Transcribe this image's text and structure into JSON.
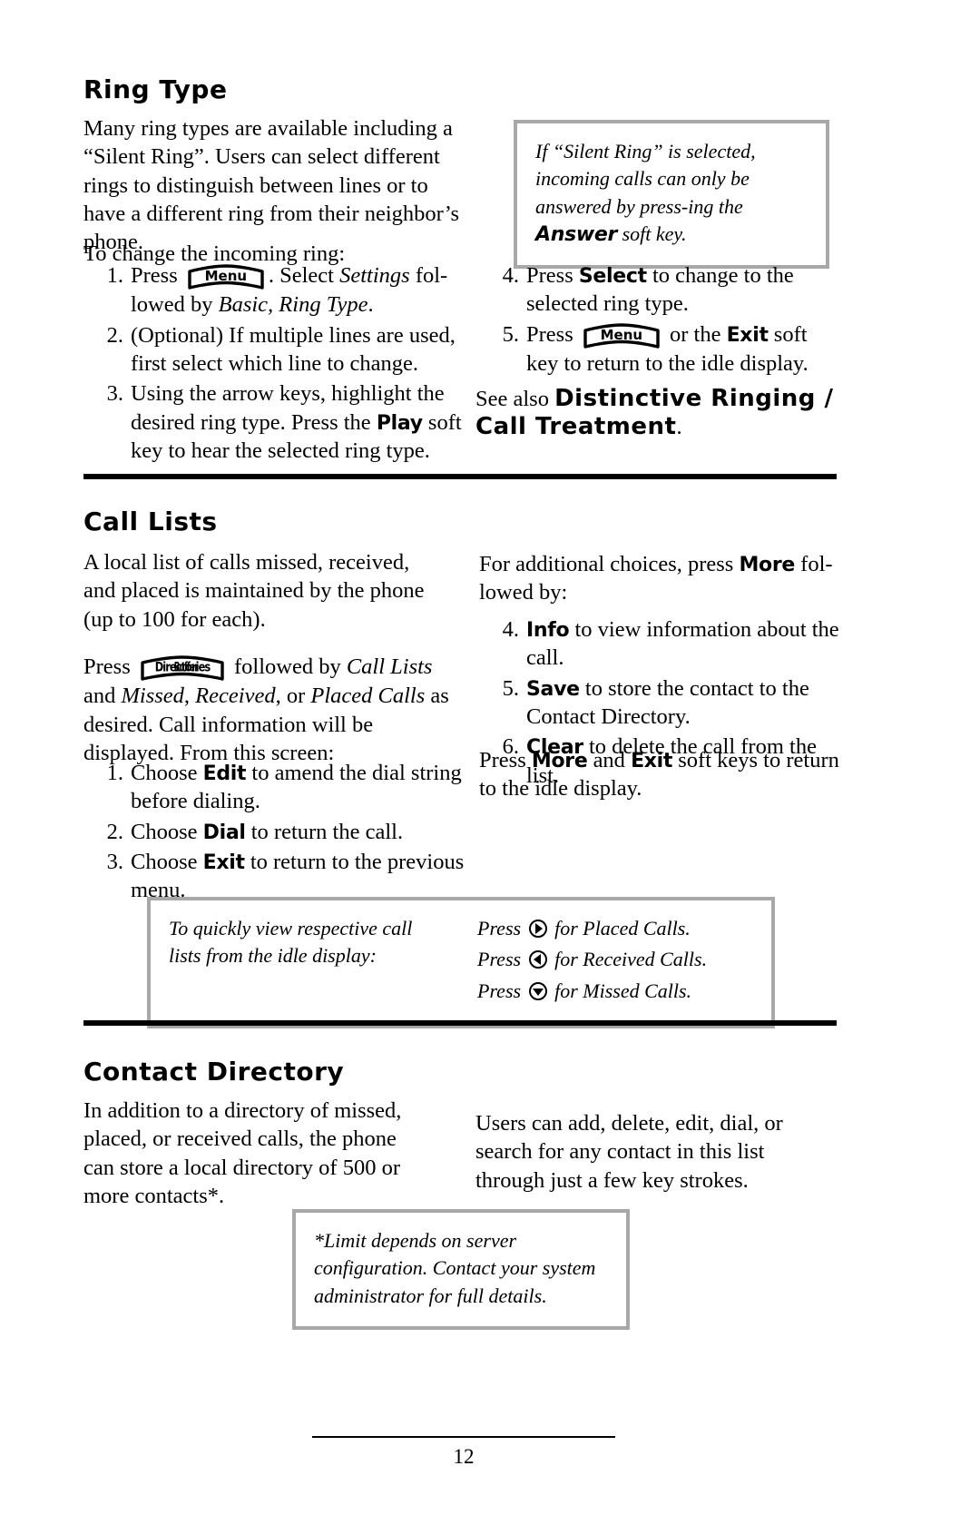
{
  "document": {
    "page_number": "12"
  },
  "sections": [
    {
      "id": "ring_type",
      "title": "Ring Type",
      "intro": "Many ring types are available including a “Silent Ring”.  Users can select different rings to distinguish between lines or to have a different ring from their neighbor’s phone.",
      "lead_in": "To change the incoming ring:",
      "steps_left": [
        {
          "num": "1.",
          "pre": "Press ",
          "key": "Menu",
          "post_plain": ". Select ",
          "post_italic": "Settings",
          "post_plain2": " fol-lowed by ",
          "post_italic2": "Basic, Ring Type",
          "post_plain3": "."
        },
        {
          "num": "2.",
          "text": "(Optional)  If multiple lines are used, first select which line to change."
        },
        {
          "num": "3.",
          "pre": "Using the arrow keys, highlight the desired ring type.  Press the ",
          "soft": "Play",
          "post": " soft key to hear the selected ring type."
        }
      ],
      "steps_right": [
        {
          "num": "4.",
          "pre": "Press ",
          "soft": "Select",
          "post": " to change to the selected ring type."
        },
        {
          "num": "5.",
          "pre": "Press ",
          "key": "Menu",
          "mid": " or the ",
          "soft": "Exit",
          "post": " soft key to return to the idle display."
        }
      ],
      "callout": "If “Silent Ring” is selected, incoming calls can only be answered by press-ing the ",
      "callout_soft": "Answer",
      "callout_tail": " soft key.",
      "see_also_prefix": "See also ",
      "see_also_bold": "Distinctive Ringing / Call Treatment",
      "see_also_suffix": "."
    },
    {
      "id": "call_lists",
      "title": "Call Lists",
      "p1": "A local list of calls missed, received, and placed is maintained by the phone (up to 100 for each).",
      "p2_pre": "Press ",
      "p2_key": "Directories",
      "p2_key_overlap": "Buffer",
      "p2_mid": " followed by ",
      "p2_italic1": "Call Lists",
      "p2_plain1": " and ",
      "p2_italic2": "Missed",
      "p2_plain2": ", ",
      "p2_italic3": "Received",
      "p2_plain3": ", or ",
      "p2_italic4": "Placed Calls",
      "p2_tail": " as desired.  Call information will be displayed.  From this screen:",
      "steps_left": [
        {
          "num": "1.",
          "pre": "Choose ",
          "soft": "Edit",
          "post": " to amend the dial string before dialing."
        },
        {
          "num": "2.",
          "pre": "Choose ",
          "soft": "Dial",
          "post": " to return the call."
        },
        {
          "num": "3.",
          "pre": "Choose ",
          "soft": "Exit",
          "post": " to return to the previous menu."
        }
      ],
      "right_intro_pre": "For additional choices, press ",
      "right_intro_soft": "More",
      "right_intro_post": " fol-lowed by:",
      "steps_right": [
        {
          "num": "4.",
          "soft": "Info",
          "text": " to view information about the call."
        },
        {
          "num": "5.",
          "soft": "Save",
          "text": " to store the contact to the Contact Directory."
        },
        {
          "num": "6.",
          "soft": "Clear",
          "text": " to delete the call from the list."
        }
      ],
      "right_tail_pre": "Press ",
      "right_tail_soft1": "More",
      "right_tail_mid": " and ",
      "right_tail_soft2": "Exit",
      "right_tail_post": " soft keys to return to the idle display.",
      "callout_left": "To quickly view respective call lists from the idle display:",
      "callout_rows": [
        {
          "pre": "Press ",
          "icon": "arrow-right-icon",
          "post": " for Placed Calls."
        },
        {
          "pre": "Press ",
          "icon": "arrow-left-icon",
          "post": " for Received Calls."
        },
        {
          "pre": "Press ",
          "icon": "arrow-down-icon",
          "post": " for Missed Calls."
        }
      ]
    },
    {
      "id": "contact_directory",
      "title": "Contact Directory",
      "left": "In addition to a directory of missed, placed, or received calls, the phone can store a local directory of 500 or more contacts*.",
      "right": "Users can add, delete, edit, dial, or search for any contact in this list through just a few key strokes.",
      "callout": "*Limit depends on server configuration. Contact your system administrator for full details."
    }
  ],
  "colors": {
    "callout_border": "#a8a8a8",
    "rule": "#000000",
    "text": "#000000",
    "background": "#ffffff"
  }
}
